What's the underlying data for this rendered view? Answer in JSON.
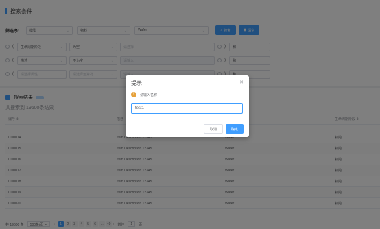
{
  "header": {
    "title": "搜索条件"
  },
  "filter": {
    "label": "筛选序:",
    "select1": "模型",
    "select2": "物料",
    "select3": "Wafer",
    "search_button": "搜索",
    "reset_button": "清空"
  },
  "conditions": [
    {
      "paren_open": "(",
      "field": "生命周期阶段",
      "op": "为空",
      "value": "请选择",
      "paren_close": ")",
      "logic": "和"
    },
    {
      "paren_open": "(",
      "field": "描述",
      "op": "不为空",
      "value": "请输入",
      "paren_close": ")",
      "logic": "和"
    },
    {
      "paren_open": "(",
      "field": "请选择属性",
      "op": "请选择运算符",
      "value": "请输入",
      "paren_close": ")",
      "logic": "和"
    }
  ],
  "results": {
    "title": "搜索结果",
    "count_text": "共搜索到 19600条结果",
    "columns": [
      "编号",
      "描述",
      "",
      "生命周期阶段"
    ],
    "rows": [
      [
        "IT00014",
        "Item Description 12345",
        "Wafer",
        "初始"
      ],
      [
        "IT00015",
        "Item Description 12345",
        "Wafer",
        "初始"
      ],
      [
        "IT00016",
        "Item Description 12345",
        "Wafer",
        "初始"
      ],
      [
        "IT00017",
        "Item Description 12345",
        "Wafer",
        "初始"
      ],
      [
        "IT00018",
        "Item Description 12345",
        "Wafer",
        "初始"
      ],
      [
        "IT00019",
        "Item Description 12345",
        "Wafer",
        "初始"
      ],
      [
        "IT00020",
        "Item Description 12345",
        "Wafer",
        "初始"
      ]
    ]
  },
  "pagination": {
    "total": "共 19600 条",
    "page_size": "500条/页",
    "pages": [
      "1",
      "2",
      "3",
      "4",
      "5",
      "6",
      "...",
      "40"
    ],
    "goto_label": "前往",
    "goto_value": "1",
    "page_suffix": "页"
  },
  "dialog": {
    "title": "提示",
    "message": "请输入名称",
    "input_value": "test1",
    "cancel": "取消",
    "confirm": "确定"
  },
  "colors": {
    "primary": "#409eff",
    "warning": "#e6a23c"
  }
}
